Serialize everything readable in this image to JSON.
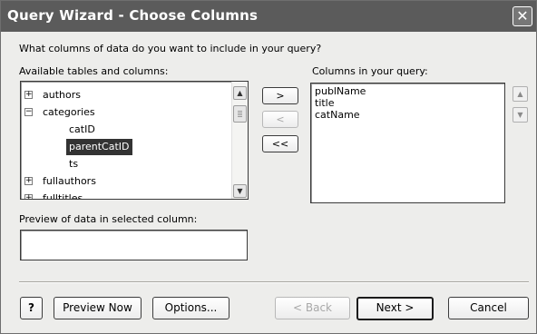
{
  "window": {
    "title": "Query Wizard - Choose Columns",
    "close_glyph": "✕"
  },
  "prompt": "What columns of data do you want to include in your query?",
  "available_label": "Available tables and columns:",
  "query_label": "Columns in your query:",
  "tree": {
    "tables": [
      {
        "expander": "+",
        "label": "authors"
      },
      {
        "expander": "−",
        "label": "categories"
      },
      {
        "expander": "+",
        "label": "fullauthors"
      },
      {
        "expander": "+",
        "label": "fulltitles"
      }
    ],
    "children": [
      "catID",
      "parentCatID",
      "ts"
    ],
    "selected": "parentCatID"
  },
  "query_columns": [
    "publName",
    "title",
    "catName"
  ],
  "move_buttons": {
    "add": ">",
    "remove": "<",
    "remove_all": "<<"
  },
  "preview_label": "Preview of data in selected column:",
  "preview_value": "",
  "buttons": {
    "help": "?",
    "preview_now": "Preview Now",
    "options": "Options...",
    "back": "< Back",
    "next": "Next >",
    "cancel": "Cancel"
  }
}
